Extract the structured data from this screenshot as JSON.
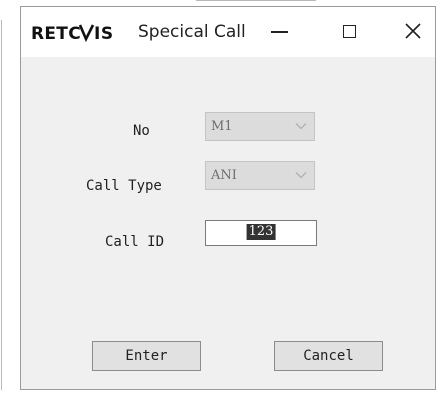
{
  "window": {
    "logo_text": "RETEVIS",
    "title": "Specical Call"
  },
  "form": {
    "no_label": "No",
    "no_value": "M1",
    "call_type_label": "Call Type",
    "call_type_value": "ANI",
    "call_id_label": "Call ID",
    "call_id_value": "123"
  },
  "buttons": {
    "enter": "Enter",
    "cancel": "Cancel"
  },
  "colors": {
    "disabled_combo_bg": "#dcdcdc",
    "selection_bg": "#333333",
    "dialog_bg": "#f0f0f0"
  },
  "icons": [
    "minimize-icon",
    "maximize-icon",
    "close-icon",
    "chevron-down-icon"
  ]
}
